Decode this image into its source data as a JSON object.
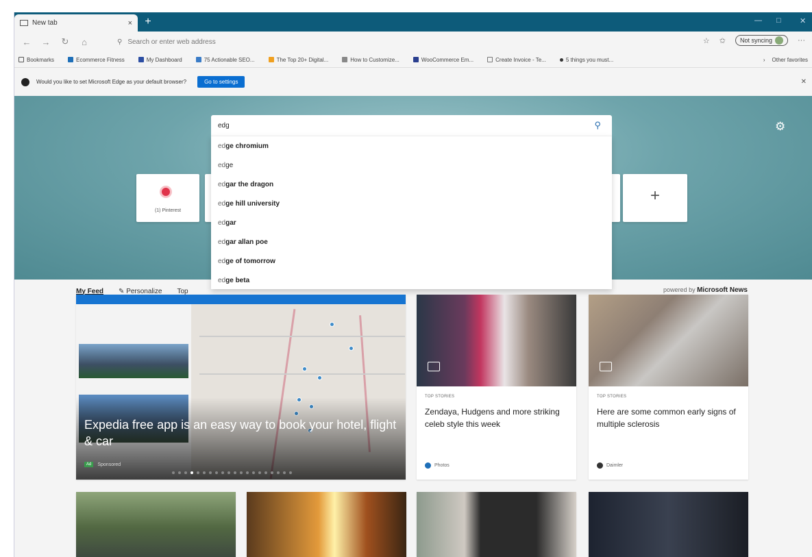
{
  "browser": {
    "tab_title": "New tab",
    "new_tab_symbol": "+",
    "address_placeholder": "Search or enter web address",
    "sync_label": "Not syncing",
    "window_controls": [
      "—",
      "□",
      "✕"
    ]
  },
  "favorites": {
    "items": [
      {
        "label": "Bookmarks",
        "color": "#555555"
      },
      {
        "label": "Ecommerce Fitness",
        "color": "#1e6fb8"
      },
      {
        "label": "My Dashboard",
        "color": "#2c4ea3"
      },
      {
        "label": "75 Actionable SEO...",
        "color": "#3a7cc7"
      },
      {
        "label": "The Top 20+ Digital...",
        "color": "#f0a020"
      },
      {
        "label": "How to Customize...",
        "color": "#888888"
      },
      {
        "label": "WooCommerce Em...",
        "color": "#2a3f8f"
      },
      {
        "label": "Create Invoice - Te...",
        "color": "#777777"
      },
      {
        "label": "5 things you must...",
        "color": "#333333"
      }
    ],
    "overflow": "›",
    "other_favorites": "Other favorites"
  },
  "infobar": {
    "message": "Would you like to set Microsoft Edge as your default browser?",
    "button": "Go to settings",
    "close": "✕"
  },
  "newtab": {
    "search_query": "edg",
    "suggestions": [
      {
        "match": "ed",
        "rest": "ge chromium"
      },
      {
        "match": "ed",
        "rest": "ge"
      },
      {
        "match": "ed",
        "rest": "gar the dragon"
      },
      {
        "match": "ed",
        "rest": "ge hill university"
      },
      {
        "match": "ed",
        "rest": "gar"
      },
      {
        "match": "ed",
        "rest": "gar allan poe"
      },
      {
        "match": "ed",
        "rest": "ge of tomorrow"
      },
      {
        "match": "ed",
        "rest": "ge beta"
      }
    ],
    "tiles": [
      {
        "label": "(1) Pinterest"
      },
      {
        "label": "+"
      }
    ],
    "settings_icon": "gear-icon"
  },
  "feed": {
    "tabs": [
      "My Feed",
      "Personalize",
      "Top"
    ],
    "powered_prefix": "powered by",
    "powered_brand": "Microsoft News",
    "big_card": {
      "headline": "Expedia free app is an easy way to book your hotel, flight & car",
      "badge": "Ad",
      "sponsor": "Sponsored",
      "dots_total": 20,
      "dot_active": 3
    },
    "stories": [
      {
        "category": "TOP STORIES",
        "title": "Zendaya, Hudgens and more striking celeb style this week",
        "source": "Photos",
        "source_color": "#1e6fb8"
      },
      {
        "category": "TOP STORIES",
        "title": "Here are some common early signs of multiple sclerosis",
        "source": "Daimler",
        "source_color": "#333333"
      }
    ]
  }
}
